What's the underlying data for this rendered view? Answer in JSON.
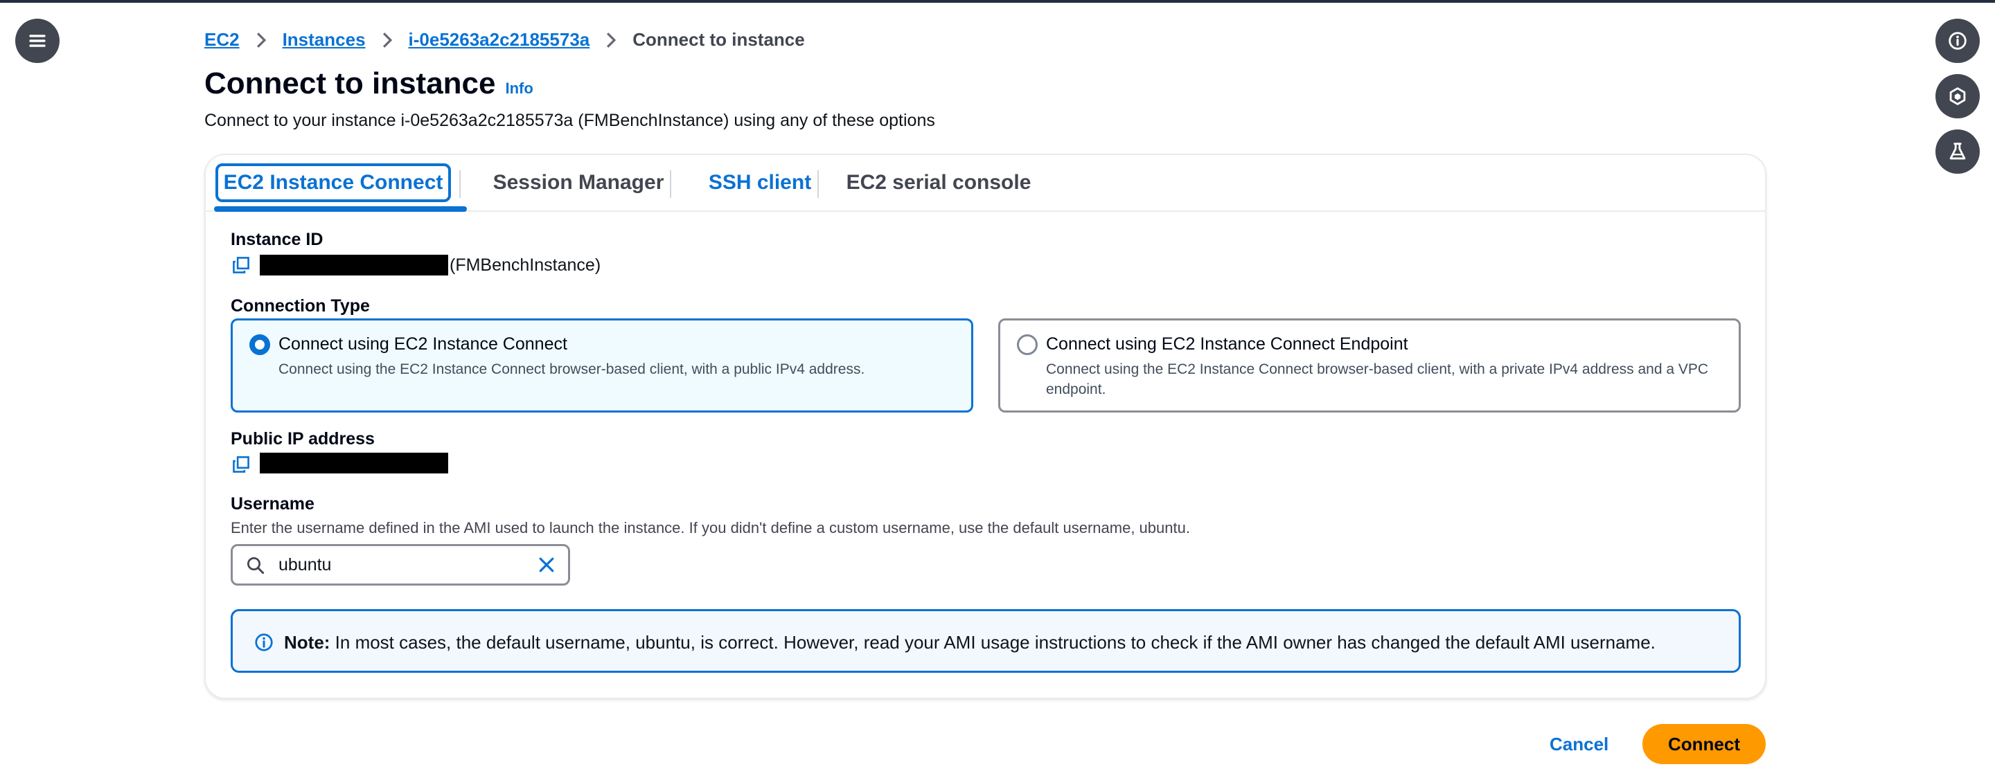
{
  "breadcrumb": {
    "items": [
      {
        "label": "EC2"
      },
      {
        "label": "Instances"
      },
      {
        "label": "i-0e5263a2c2185573a"
      }
    ],
    "current": "Connect to instance"
  },
  "page": {
    "title": "Connect to instance",
    "info_link": "Info",
    "subtitle": "Connect to your instance i-0e5263a2c2185573a (FMBenchInstance) using any of these options"
  },
  "tabs": [
    {
      "label": "EC2 Instance Connect",
      "state": "active"
    },
    {
      "label": "Session Manager",
      "state": "normal"
    },
    {
      "label": "SSH client",
      "state": "link"
    },
    {
      "label": "EC2 serial console",
      "state": "normal"
    }
  ],
  "instance": {
    "label": "Instance ID",
    "name_suffix": "(FMBenchInstance)"
  },
  "connection_type": {
    "label": "Connection Type",
    "options": [
      {
        "title": "Connect using EC2 Instance Connect",
        "desc": "Connect using the EC2 Instance Connect browser-based client, with a public IPv4 address.",
        "selected": true
      },
      {
        "title": "Connect using EC2 Instance Connect Endpoint",
        "desc": "Connect using the EC2 Instance Connect browser-based client, with a private IPv4 address and a VPC endpoint.",
        "selected": false
      }
    ]
  },
  "public_ip": {
    "label": "Public IP address"
  },
  "username": {
    "label": "Username",
    "hint": "Enter the username defined in the AMI used to launch the instance. If you didn't define a custom username, use the default username, ubuntu.",
    "value": "ubuntu"
  },
  "alert": {
    "bold": "Note:",
    "text": " In most cases, the default username, ubuntu, is correct. However, read your AMI usage instructions to check if the AMI owner has changed the default AMI username."
  },
  "actions": {
    "cancel": "Cancel",
    "connect": "Connect"
  },
  "colors": {
    "primary": "#0972d3",
    "connect_button": "#ff9900",
    "side_buttons": "#424650"
  },
  "icons": {
    "menu": "hamburger-menu-icon",
    "info": "info-icon",
    "hex": "hexagon-icon",
    "flask": "flask-icon",
    "copy": "copy-icon",
    "search": "search-icon",
    "clear": "close-icon"
  }
}
